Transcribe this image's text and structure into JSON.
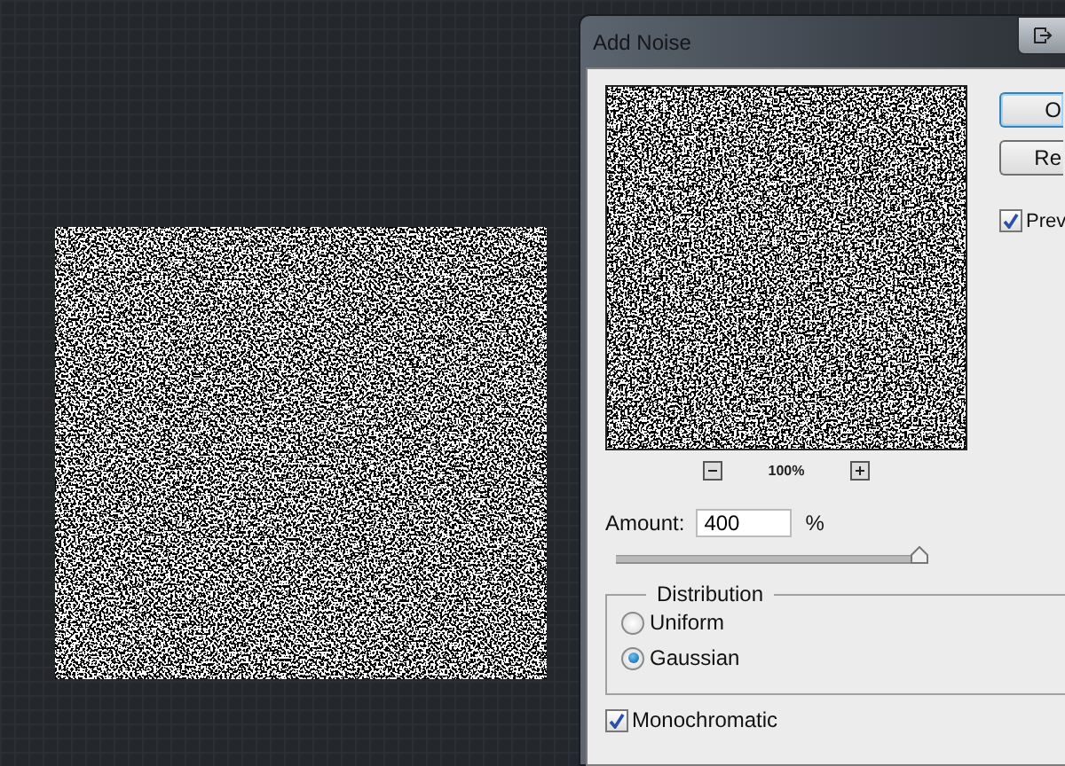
{
  "window": {
    "title": "Add Noise"
  },
  "preview_zoom": {
    "reading": "100%"
  },
  "amount": {
    "label": "Amount:",
    "value": "400",
    "unit": "%",
    "level": 1
  },
  "distribution": {
    "legend": "Distribution",
    "options": [
      {
        "label": "Uniform",
        "selected": false
      },
      {
        "label": "Gaussian",
        "selected": true
      }
    ]
  },
  "monochromatic": {
    "label": "Monochromatic",
    "checked": true
  },
  "buttons": [
    {
      "label": "O",
      "default": true
    },
    {
      "label": "Re",
      "default": false
    }
  ],
  "preview": {
    "label": "Prev",
    "checked": true
  }
}
